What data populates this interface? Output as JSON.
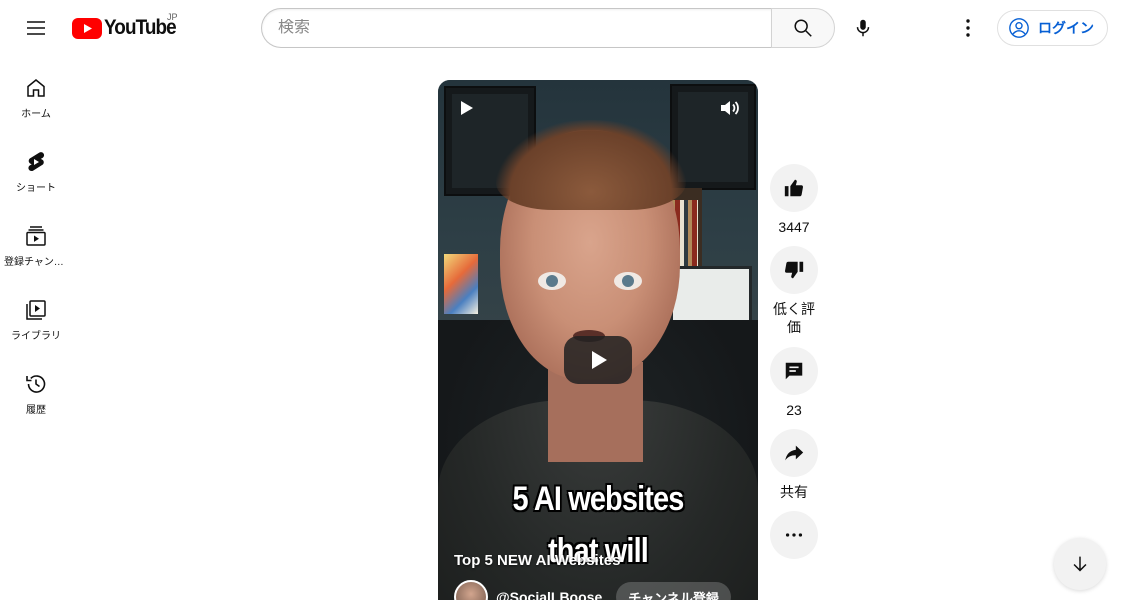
{
  "header": {
    "logo_text": "YouTube",
    "logo_region": "JP",
    "search_placeholder": "検索",
    "login_label": "ログイン"
  },
  "sidebar": {
    "items": [
      {
        "label": "ホーム",
        "icon": "home-icon"
      },
      {
        "label": "ショート",
        "icon": "shorts-icon"
      },
      {
        "label": "登録チャンネル",
        "icon": "subscriptions-icon"
      },
      {
        "label": "ライブラリ",
        "icon": "library-icon"
      },
      {
        "label": "履歴",
        "icon": "history-icon"
      }
    ]
  },
  "video": {
    "caption_line1": "5 AI websites",
    "caption_line2": "that will",
    "title": "Top 5 NEW AI Websites",
    "channel": "@SocialLBoose",
    "subscribe_label": "チャンネル登録"
  },
  "actions": {
    "like_count": "3447",
    "dislike_label": "低く評価",
    "comment_count": "23",
    "share_label": "共有"
  },
  "colors": {
    "brand_red": "#ff0000",
    "link_blue": "#065fd4"
  }
}
